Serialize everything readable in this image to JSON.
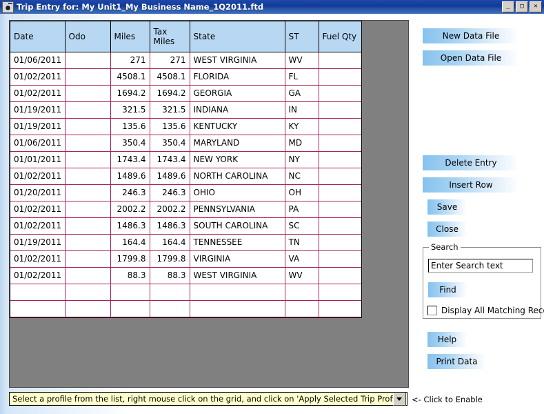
{
  "window": {
    "title": "Trip Entry for: My Unit1_My Business Name_1Q2011.ftd",
    "icon": "app-icon",
    "controls": {
      "minimize": "_",
      "maximize": "□",
      "close": "✕"
    }
  },
  "grid": {
    "columns": [
      "Date",
      "Odo",
      "Miles",
      "Tax\nMiles",
      "State",
      "ST",
      "Fuel Qty"
    ],
    "column_labels": {
      "date": "Date",
      "odo": "Odo",
      "miles": "Miles",
      "tax_miles_line1": "Tax",
      "tax_miles_line2": "Miles",
      "state": "State",
      "st": "ST",
      "fuel_qty": "Fuel Qty"
    },
    "rows": [
      {
        "date": "01/06/2011",
        "odo": "",
        "miles": "271",
        "tax_miles": "271",
        "state": "WEST VIRGINIA",
        "st": "WV",
        "fuel_qty": ""
      },
      {
        "date": "01/02/2011",
        "odo": "",
        "miles": "4508.1",
        "tax_miles": "4508.1",
        "state": "FLORIDA",
        "st": "FL",
        "fuel_qty": ""
      },
      {
        "date": "01/02/2011",
        "odo": "",
        "miles": "1694.2",
        "tax_miles": "1694.2",
        "state": "GEORGIA",
        "st": "GA",
        "fuel_qty": ""
      },
      {
        "date": "01/19/2011",
        "odo": "",
        "miles": "321.5",
        "tax_miles": "321.5",
        "state": "INDIANA",
        "st": "IN",
        "fuel_qty": ""
      },
      {
        "date": "01/19/2011",
        "odo": "",
        "miles": "135.6",
        "tax_miles": "135.6",
        "state": "KENTUCKY",
        "st": "KY",
        "fuel_qty": ""
      },
      {
        "date": "01/06/2011",
        "odo": "",
        "miles": "350.4",
        "tax_miles": "350.4",
        "state": "MARYLAND",
        "st": "MD",
        "fuel_qty": ""
      },
      {
        "date": "01/01/2011",
        "odo": "",
        "miles": "1743.4",
        "tax_miles": "1743.4",
        "state": "NEW YORK",
        "st": "NY",
        "fuel_qty": ""
      },
      {
        "date": "01/02/2011",
        "odo": "",
        "miles": "1489.6",
        "tax_miles": "1489.6",
        "state": "NORTH CAROLINA",
        "st": "NC",
        "fuel_qty": ""
      },
      {
        "date": "01/20/2011",
        "odo": "",
        "miles": "246.3",
        "tax_miles": "246.3",
        "state": "OHIO",
        "st": "OH",
        "fuel_qty": ""
      },
      {
        "date": "01/02/2011",
        "odo": "",
        "miles": "2002.2",
        "tax_miles": "2002.2",
        "state": "PENNSYLVANIA",
        "st": "PA",
        "fuel_qty": ""
      },
      {
        "date": "01/02/2011",
        "odo": "",
        "miles": "1486.3",
        "tax_miles": "1486.3",
        "state": "SOUTH CAROLINA",
        "st": "SC",
        "fuel_qty": ""
      },
      {
        "date": "01/19/2011",
        "odo": "",
        "miles": "164.4",
        "tax_miles": "164.4",
        "state": "TENNESSEE",
        "st": "TN",
        "fuel_qty": ""
      },
      {
        "date": "01/02/2011",
        "odo": "",
        "miles": "1799.8",
        "tax_miles": "1799.8",
        "state": "VIRGINIA",
        "st": "VA",
        "fuel_qty": ""
      },
      {
        "date": "01/02/2011",
        "odo": "",
        "miles": "88.3",
        "tax_miles": "88.3",
        "state": "WEST VIRGINIA",
        "st": "WV",
        "fuel_qty": ""
      },
      {
        "date": "",
        "odo": "",
        "miles": "",
        "tax_miles": "",
        "state": "",
        "st": "",
        "fuel_qty": ""
      },
      {
        "date": "",
        "odo": "",
        "miles": "",
        "tax_miles": "",
        "state": "",
        "st": "",
        "fuel_qty": ""
      }
    ]
  },
  "buttons": {
    "new_data_file": "New Data File",
    "open_data_file": "Open Data File",
    "delete_entry": "Delete Entry",
    "insert_row": "Insert Row",
    "save": "Save",
    "close": "Close",
    "help": "Help",
    "print_data": "Print Data"
  },
  "search": {
    "legend": "Search",
    "input_value": "Enter Search text",
    "find_label": "Find",
    "checkbox_label": "Display All Matching Records",
    "checkbox_checked": false
  },
  "footer": {
    "profile_text": "Select a profile from the list, right mouse click on the grid, and click on 'Apply Selected Trip Profile'.",
    "hint": "<- Click to Enable"
  },
  "colors": {
    "titlebar": "#0f3a9c",
    "header_fill": "#b7d7f3",
    "gridline": "#a4235c",
    "button_accent": "#86c2ee",
    "panel_gray": "#808080",
    "combo_yellow": "#ffffcc"
  }
}
